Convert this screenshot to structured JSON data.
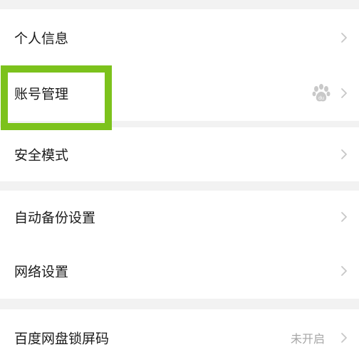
{
  "settings": {
    "items": [
      {
        "label": "个人信息"
      },
      {
        "label": "账号管理"
      },
      {
        "label": "安全模式"
      },
      {
        "label": "自动备份设置"
      },
      {
        "label": "网络设置"
      },
      {
        "label": "百度网盘锁屏码",
        "status": "未开启"
      }
    ]
  },
  "icons": {
    "chevron": "chevron-right-icon",
    "account_provider": "baidu-paw-icon"
  },
  "colors": {
    "highlight": "#7cc21c",
    "chevron": "#c7c7c7",
    "paw": "#c9c9c9",
    "label": "#1a1a1a",
    "status": "#a6a6a6",
    "background": "#f2f2f2"
  }
}
